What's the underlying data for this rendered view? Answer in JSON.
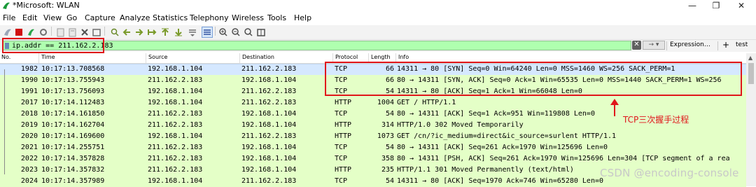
{
  "window": {
    "title": "*Microsoft: WLAN",
    "minimize": "—",
    "maximize": "❐",
    "close": "✕"
  },
  "menu": [
    "File",
    "Edit",
    "View",
    "Go",
    "Capture",
    "Analyze",
    "Statistics",
    "Telephony",
    "Wireless",
    "Tools",
    "Help"
  ],
  "filter": {
    "value": "ip.addr == 211.162.2.183",
    "clear": "✕",
    "apply": "→ ▾",
    "expression": "Expression…",
    "plus": "+",
    "test_button": "test"
  },
  "columns": [
    "No.",
    "Time",
    "Source",
    "Destination",
    "Protocol",
    "Length",
    "Info"
  ],
  "packets": [
    {
      "no": "1982",
      "time": "10:17:13.708568",
      "src": "192.168.1.104",
      "dst": "211.162.2.183",
      "proto": "TCP",
      "len": "66",
      "info": "14311 → 80 [SYN] Seq=0 Win=64240 Len=0 MSS=1460 WS=256 SACK_PERM=1"
    },
    {
      "no": "1990",
      "time": "10:17:13.755943",
      "src": "211.162.2.183",
      "dst": "192.168.1.104",
      "proto": "TCP",
      "len": "66",
      "info": "80 → 14311 [SYN, ACK] Seq=0 Ack=1 Win=65535 Len=0 MSS=1440 SACK_PERM=1 WS=256"
    },
    {
      "no": "1991",
      "time": "10:17:13.756093",
      "src": "192.168.1.104",
      "dst": "211.162.2.183",
      "proto": "TCP",
      "len": "54",
      "info": "14311 → 80 [ACK] Seq=1 Ack=1 Win=66048 Len=0"
    },
    {
      "no": "2017",
      "time": "10:17:14.112483",
      "src": "192.168.1.104",
      "dst": "211.162.2.183",
      "proto": "HTTP",
      "len": "1004",
      "info": "GET / HTTP/1.1"
    },
    {
      "no": "2018",
      "time": "10:17:14.161850",
      "src": "211.162.2.183",
      "dst": "192.168.1.104",
      "proto": "TCP",
      "len": "54",
      "info": "80 → 14311 [ACK] Seq=1 Ack=951 Win=119808 Len=0"
    },
    {
      "no": "2019",
      "time": "10:17:14.162704",
      "src": "211.162.2.183",
      "dst": "192.168.1.104",
      "proto": "HTTP",
      "len": "314",
      "info": "HTTP/1.0 302 Moved Temporarily"
    },
    {
      "no": "2020",
      "time": "10:17:14.169600",
      "src": "192.168.1.104",
      "dst": "211.162.2.183",
      "proto": "HTTP",
      "len": "1073",
      "info": "GET /cn/?ic_medium=direct&ic_source=surlent HTTP/1.1"
    },
    {
      "no": "2021",
      "time": "10:17:14.255751",
      "src": "211.162.2.183",
      "dst": "192.168.1.104",
      "proto": "TCP",
      "len": "54",
      "info": "80 → 14311 [ACK] Seq=261 Ack=1970 Win=125696 Len=0"
    },
    {
      "no": "2022",
      "time": "10:17:14.357828",
      "src": "211.162.2.183",
      "dst": "192.168.1.104",
      "proto": "TCP",
      "len": "358",
      "info": "80 → 14311 [PSH, ACK] Seq=261 Ack=1970 Win=125696 Len=304 [TCP segment of a rea"
    },
    {
      "no": "2023",
      "time": "10:17:14.357832",
      "src": "211.162.2.183",
      "dst": "192.168.1.104",
      "proto": "HTTP",
      "len": "235",
      "info": "HTTP/1.1 301 Moved Permanently  (text/html)"
    },
    {
      "no": "2024",
      "time": "10:17:14.357989",
      "src": "192.168.1.104",
      "dst": "211.162.2.183",
      "proto": "TCP",
      "len": "54",
      "info": "14311 → 80 [ACK] Seq=1970 Ack=746 Win=65280 Len=0"
    }
  ],
  "annotation": "TCP三次握手过程",
  "watermark": "CSDN @encoding-console",
  "colors": {
    "row_bg": "#e4ffc7",
    "selected_bg": "#d5e8ff",
    "filter_valid": "#afffaf",
    "highlight_red": "#e0161b"
  }
}
